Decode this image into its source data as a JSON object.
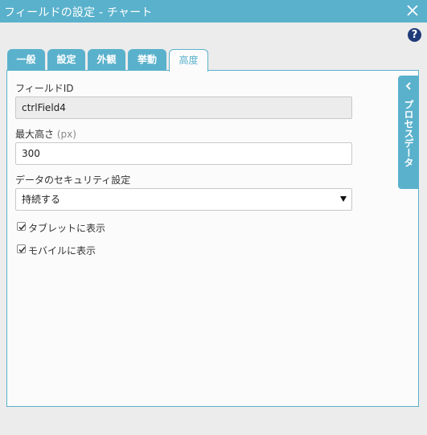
{
  "window": {
    "title": "フィールドの設定 - チャート",
    "close_icon": "close-icon",
    "help_label": "?"
  },
  "tabs": [
    {
      "label": "一般"
    },
    {
      "label": "設定"
    },
    {
      "label": "外観"
    },
    {
      "label": "挙動"
    },
    {
      "label": "高度",
      "active": true
    }
  ],
  "form": {
    "field_id_label": "フィールドID",
    "field_id_value": "ctrlField4",
    "max_height_label": "最大高さ",
    "max_height_unit": "(px)",
    "max_height_value": "300",
    "security_label": "データのセキュリティ設定",
    "security_value": "持続する",
    "show_tablet_label": "タブレットに表示",
    "show_tablet_checked": true,
    "show_mobile_label": "モバイルに表示",
    "show_mobile_checked": true
  },
  "side_panel": {
    "label": "プロセスデータ",
    "icon": "chevron-left-icon"
  },
  "colors": {
    "accent": "#5ab1cc",
    "help": "#1f3b78"
  }
}
